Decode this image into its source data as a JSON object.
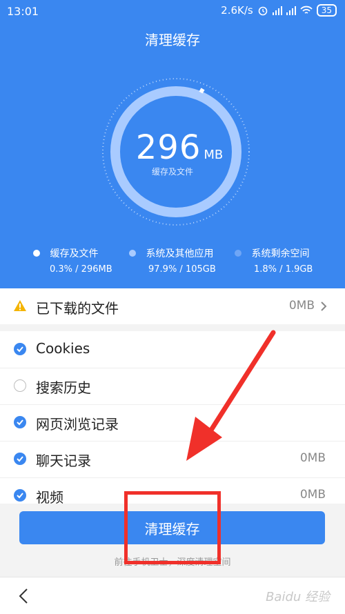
{
  "status_bar": {
    "time": "13:01",
    "net_speed": "2.6K/s",
    "battery": "35"
  },
  "header": {
    "title": "清理缓存"
  },
  "gauge": {
    "value": "296",
    "unit": "MB",
    "caption": "缓存及文件"
  },
  "legend": [
    {
      "label": "缓存及文件",
      "value": "0.3% / 296MB",
      "color": "#ffffff"
    },
    {
      "label": "系统及其他应用",
      "value": "97.9% / 105GB",
      "color": "#a9cbff"
    },
    {
      "label": "系统剩余空间",
      "value": "1.8% / 1.9GB",
      "color": "#6fa6f6"
    }
  ],
  "downloaded": {
    "label": "已下载的文件",
    "value": "0MB"
  },
  "items": [
    {
      "label": "Cookies",
      "checked": true,
      "value": ""
    },
    {
      "label": "搜索历史",
      "checked": false,
      "value": ""
    },
    {
      "label": "网页浏览记录",
      "checked": true,
      "value": ""
    },
    {
      "label": "聊天记录",
      "checked": true,
      "value": "0MB"
    },
    {
      "label": "视频",
      "checked": true,
      "value": "0MB"
    }
  ],
  "action": {
    "label": "清理缓存"
  },
  "footer": {
    "text": "前往手机卫士，深度清理空间"
  },
  "watermark": "Baidu 经验",
  "colors": {
    "primary": "#3a87f0",
    "warning": "#f4b400",
    "annotation": "#f0302a"
  }
}
